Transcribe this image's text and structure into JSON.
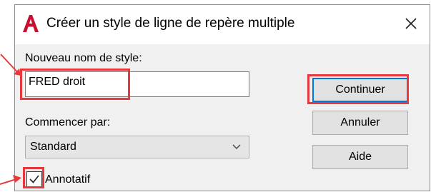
{
  "window": {
    "title": "Créer un style de ligne de repère multiple",
    "close_icon": "close-icon",
    "logo_icon": "autocad-logo"
  },
  "form": {
    "name_label": "Nouveau nom de style:",
    "name_value": "FRED droit",
    "start_label": "Commencer par:",
    "start_selected": "Standard",
    "annotative_label": "Annotatif",
    "annotative_checked": true
  },
  "buttons": {
    "continue_label": "Continuer",
    "cancel_label": "Annuler",
    "help_label": "Aide"
  },
  "colors": {
    "highlight": "#e8383d",
    "arrow": "#e8383d",
    "logo": "#c8102e",
    "focus": "#0078d7"
  }
}
